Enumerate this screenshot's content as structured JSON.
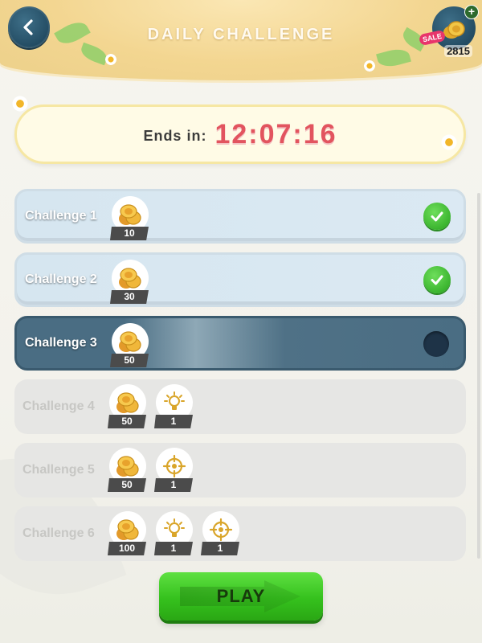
{
  "header": {
    "title": "DAILY CHALLENGE",
    "back_icon": "back-arrow-icon",
    "coins": "2815",
    "sale_label": "SALE",
    "plus_label": "+"
  },
  "timer": {
    "label": "Ends in:",
    "value": "12:07:16"
  },
  "challenges": [
    {
      "label": "Challenge 1",
      "state": "completed",
      "rewards": [
        {
          "icon": "coins-icon",
          "amount": "10"
        }
      ]
    },
    {
      "label": "Challenge 2",
      "state": "completed",
      "rewards": [
        {
          "icon": "coins-icon",
          "amount": "30"
        }
      ]
    },
    {
      "label": "Challenge 3",
      "state": "current",
      "rewards": [
        {
          "icon": "coins-icon",
          "amount": "50"
        }
      ]
    },
    {
      "label": "Challenge 4",
      "state": "locked",
      "rewards": [
        {
          "icon": "coins-icon",
          "amount": "50"
        },
        {
          "icon": "lightbulb-icon",
          "amount": "1"
        }
      ]
    },
    {
      "label": "Challenge 5",
      "state": "locked",
      "rewards": [
        {
          "icon": "coins-icon",
          "amount": "50"
        },
        {
          "icon": "target-icon",
          "amount": "1"
        }
      ]
    },
    {
      "label": "Challenge 6",
      "state": "locked",
      "rewards": [
        {
          "icon": "coins-icon",
          "amount": "100"
        },
        {
          "icon": "lightbulb-icon",
          "amount": "1"
        },
        {
          "icon": "target-icon",
          "amount": "1"
        }
      ]
    }
  ],
  "play_button": {
    "label": "PLAY"
  },
  "colors": {
    "completed_row": "#d6e6f0",
    "current_row": "#4a6d83",
    "locked_row": "#e6e6e4",
    "timer_text": "#e2545f",
    "play_green": "#35c11d"
  }
}
